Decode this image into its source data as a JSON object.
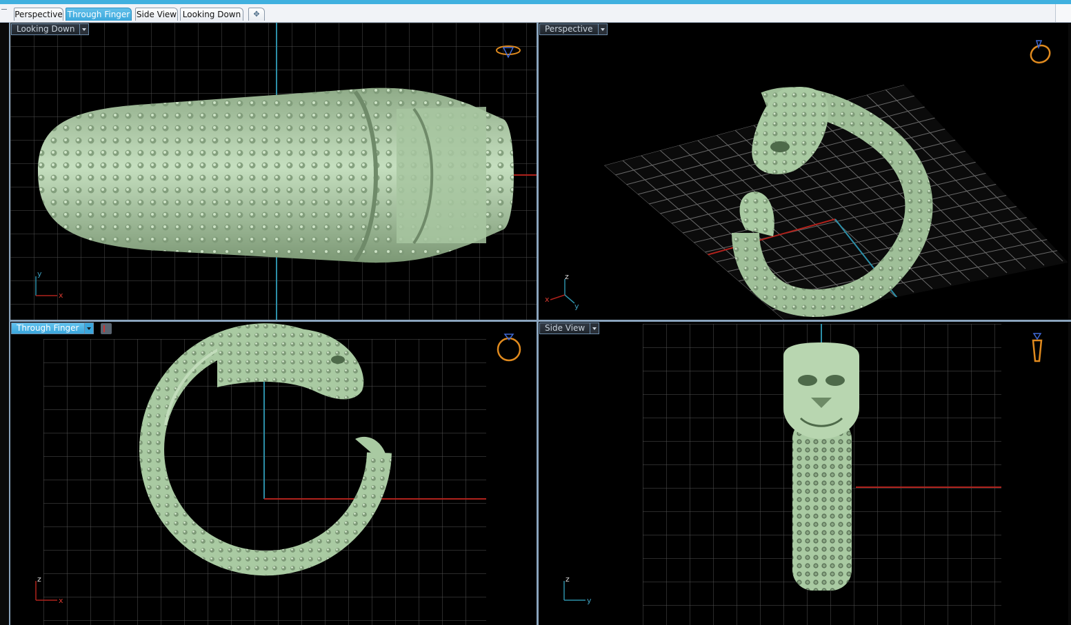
{
  "tabs": [
    {
      "label": "Perspective",
      "active": false
    },
    {
      "label": "Through Finger",
      "active": true
    },
    {
      "label": "Side View",
      "active": false
    },
    {
      "label": "Looking Down",
      "active": false
    }
  ],
  "add_tab_glyph": "✥",
  "viewports": {
    "top_left": {
      "label": "Looking Down",
      "active": false,
      "axes": [
        "y",
        "x"
      ],
      "view_icon": "ring-top-view-icon"
    },
    "top_right": {
      "label": "Perspective",
      "active": false,
      "axes": [
        "z",
        "x",
        "y"
      ],
      "view_icon": "ring-perspective-icon"
    },
    "bottom_left": {
      "label": "Through Finger",
      "active": true,
      "axes": [
        "z",
        "x"
      ],
      "view_icon": "ring-front-view-icon"
    },
    "bottom_right": {
      "label": "Side View",
      "active": false,
      "axes": [
        "z",
        "y"
      ],
      "view_icon": "ring-side-view-icon"
    }
  },
  "colors": {
    "accent": "#40b0df",
    "grid": "#5a5a5a",
    "model": "#a9caa2",
    "axis_x": "#b0221c",
    "axis_y": "#2c8fa8",
    "icon": "#e08a1e"
  }
}
